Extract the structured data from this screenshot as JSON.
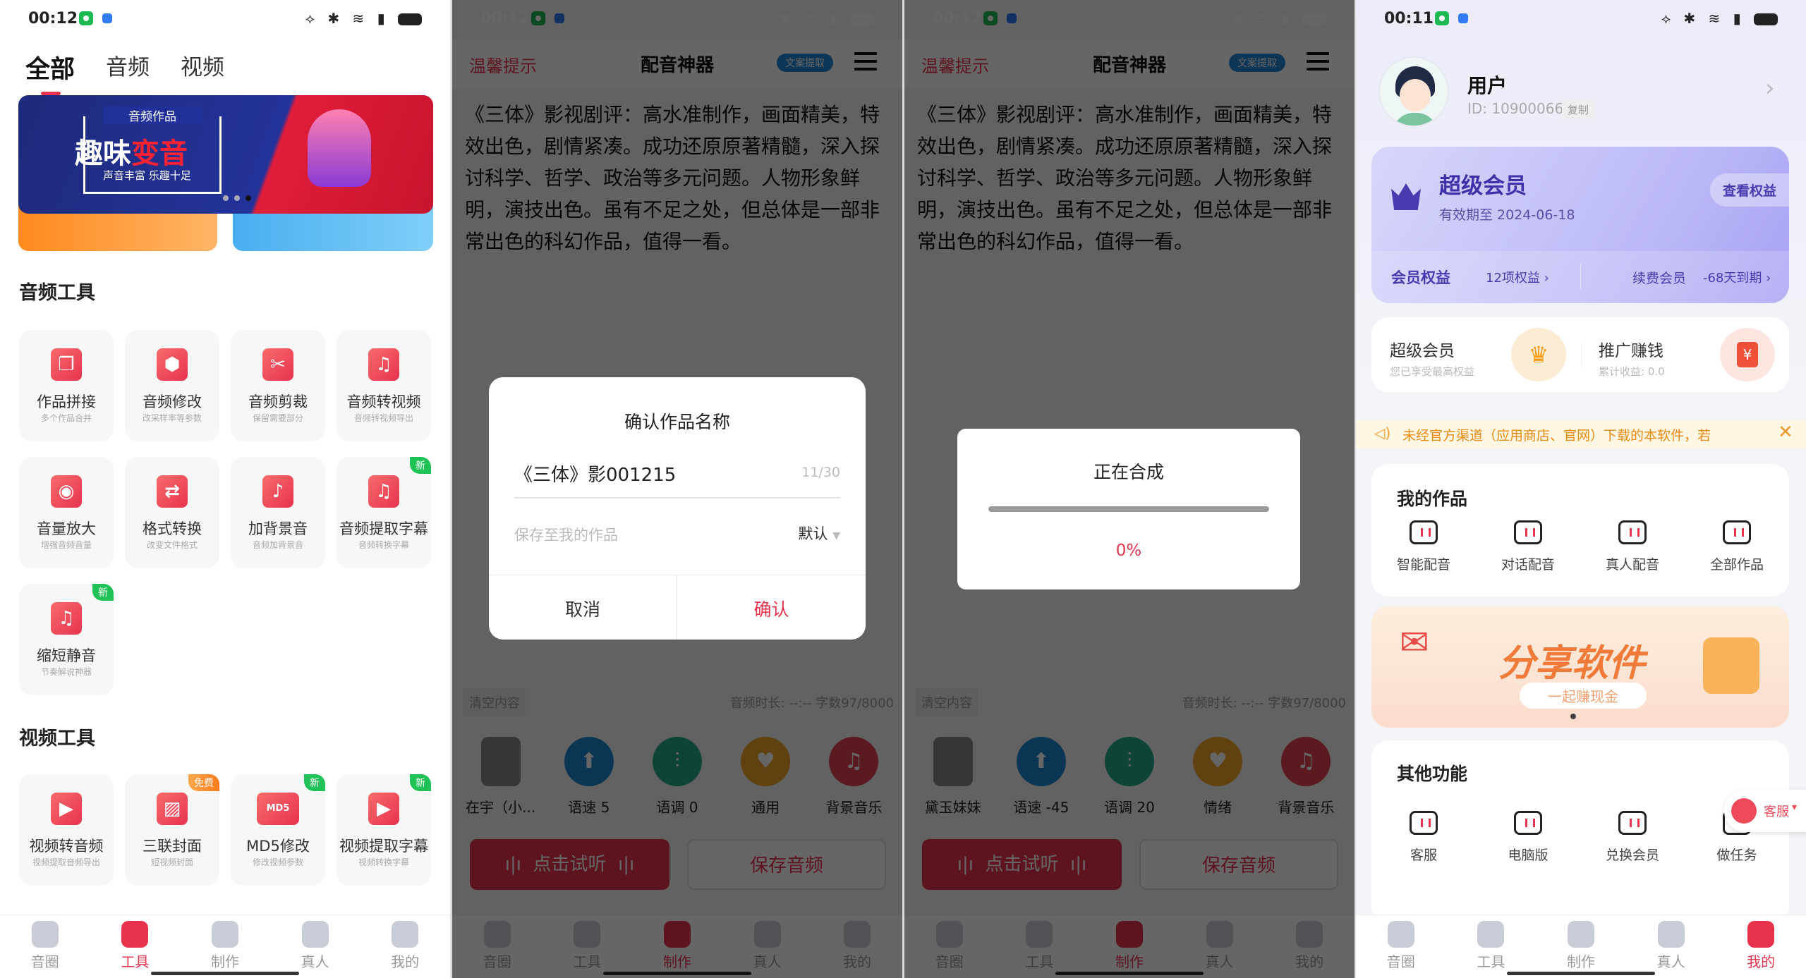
{
  "status": {
    "p1_time": "00:12",
    "p2_time": "00:12",
    "p3_time": "00:12",
    "p4_time": "00:11",
    "icons": "⟡ ✱ ≋ ▮"
  },
  "tools_page": {
    "tabs": [
      "全部",
      "音频",
      "视频"
    ],
    "banner": {
      "kicker": "音频作品",
      "headline_a": "趣味",
      "headline_b": "变音",
      "tagline": "声音丰富 乐趣十足"
    },
    "audio_section": "音频工具",
    "video_section": "视频工具",
    "audio_tools": [
      {
        "title": "作品拼接",
        "sub": "多个作品合并",
        "icon": "merge-icon",
        "badge": ""
      },
      {
        "title": "音频修改",
        "sub": "改采样率等参数",
        "icon": "hexagon-icon",
        "badge": ""
      },
      {
        "title": "音频剪裁",
        "sub": "保留需要部分",
        "icon": "scissors-icon",
        "badge": ""
      },
      {
        "title": "音频转视频",
        "sub": "音频转视频导出",
        "icon": "music-file-icon",
        "badge": ""
      },
      {
        "title": "音量放大",
        "sub": "增强音频音量",
        "icon": "speaker-icon",
        "badge": ""
      },
      {
        "title": "格式转换",
        "sub": "改变文件格式",
        "icon": "convert-icon",
        "badge": ""
      },
      {
        "title": "加背景音",
        "sub": "音频加背景音",
        "icon": "music-note-icon",
        "badge": ""
      },
      {
        "title": "音频提取字幕",
        "sub": "音频转换字幕",
        "icon": "subtitle-icon",
        "badge": "新"
      },
      {
        "title": "缩短静音",
        "sub": "节奏解说神器",
        "icon": "music-file-icon",
        "badge": "新"
      }
    ],
    "video_tools": [
      {
        "title": "视频转音频",
        "sub": "视频提取音频导出",
        "icon": "video-file-icon",
        "badge": ""
      },
      {
        "title": "三联封面",
        "sub": "短视频封面",
        "icon": "image-icon",
        "badge": "免费"
      },
      {
        "title": "MD5修改",
        "sub": "修改视频参数",
        "icon": "md5-icon",
        "badge": "新"
      },
      {
        "title": "视频提取字幕",
        "sub": "视频转换字幕",
        "icon": "play-icon",
        "badge": "新"
      }
    ]
  },
  "nav": [
    "音圈",
    "工具",
    "制作",
    "真人",
    "我的"
  ],
  "editor": {
    "tip": "温馨提示",
    "title": "配音神器",
    "extract_badge": "文案提取",
    "text": "《三体》影视剧评：高水准制作，画面精美，特效出色，剧情紧凑。成功还原原著精髓，深入探讨科学、哲学、政治等多元问题。人物形象鲜明，演技出色。虽有不足之处，但总体是一部非常出色的科幻作品，值得一看。",
    "clear": "清空内容",
    "stats": "音频时长: --:--  字数97/8000",
    "listen": "点击试听",
    "save": "保存音频"
  },
  "p2_controls": [
    "在宇（小...",
    "语速 5",
    "语调 0",
    "通用",
    "背景音乐"
  ],
  "p3_controls": [
    "黛玉妹妹",
    "语速 -45",
    "语调 20",
    "情绪",
    "背景音乐"
  ],
  "control_colors": [
    "#888",
    "#1a86d0",
    "#23a88a",
    "#f0a32a",
    "#e0434f"
  ],
  "name_dialog": {
    "title": "确认作品名称",
    "value": "《三体》影001215",
    "counter": "11/30",
    "save_to": "保存至我的作品",
    "folder": "默认",
    "cancel": "取消",
    "confirm": "确认"
  },
  "progress_dialog": {
    "title": "正在合成",
    "percent_text": "0%",
    "progress": 0
  },
  "profile": {
    "name": "用户",
    "id": "ID: 10900066",
    "copy": "复制",
    "vip_title": "超级会员",
    "vip_expiry": "有效期至 2024-06-18",
    "vip_view": "查看权益",
    "benefits": "会员权益",
    "benefits_count": "12项权益 ›",
    "renew": "续费会员",
    "renew_days": "-68天到期 ›",
    "vip2_title": "超级会员",
    "vip2_sub": "您已享受最高权益",
    "promo_title": "推广赚钱",
    "promo_sub": "累计收益: 0.0",
    "notice": "未经官方渠道（应用商店、官网）下载的本软件，若",
    "works_title": "我的作品",
    "works": [
      "智能配音",
      "对话配音",
      "真人配音",
      "全部作品"
    ],
    "share_title": "分享软件",
    "share_sub": "一起赚现金",
    "other_title": "其他功能",
    "other": [
      "客服",
      "电脑版",
      "兑换会员",
      "做任务"
    ],
    "float_service": "客服"
  },
  "colors": {
    "accent": "#e8334f",
    "vip": "#4a3ab0",
    "new_badge": "#1fc256"
  }
}
